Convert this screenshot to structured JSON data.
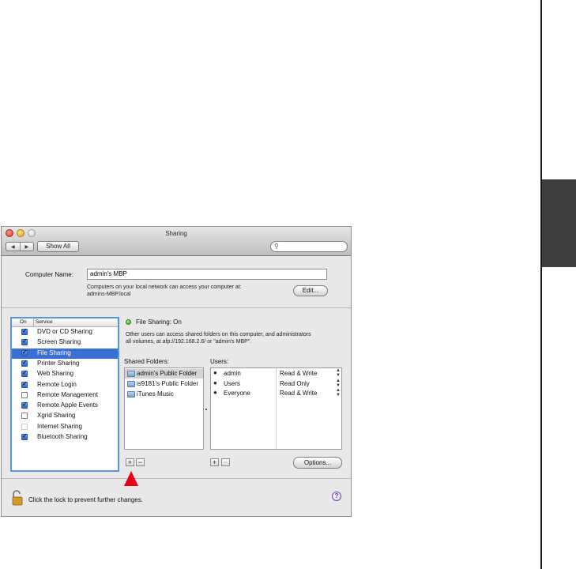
{
  "window": {
    "title": "Sharing",
    "nav_back": "◀",
    "nav_forward": "▶",
    "show_all": "Show All",
    "search_placeholder": ""
  },
  "computer_name": {
    "label": "Computer Name:",
    "value": "admin's MBP",
    "description_line1": "Computers on your local network can access your computer at:",
    "description_line2": "admins-MBP.local",
    "edit_button": "Edit..."
  },
  "services": {
    "col_on": "On",
    "col_service": "Service",
    "items": [
      {
        "name": "DVD or CD Sharing",
        "on": true,
        "selected": false
      },
      {
        "name": "Screen Sharing",
        "on": true,
        "selected": false
      },
      {
        "name": "File Sharing",
        "on": true,
        "selected": true
      },
      {
        "name": "Printer Sharing",
        "on": true,
        "selected": false
      },
      {
        "name": "Web Sharing",
        "on": true,
        "selected": false
      },
      {
        "name": "Remote Login",
        "on": true,
        "selected": false
      },
      {
        "name": "Remote Management",
        "on": false,
        "selected": false
      },
      {
        "name": "Remote Apple Events",
        "on": true,
        "selected": false
      },
      {
        "name": "Xgrid Sharing",
        "on": false,
        "selected": false
      },
      {
        "name": "Internet Sharing",
        "on": false,
        "selected": false
      },
      {
        "name": "Bluetooth Sharing",
        "on": true,
        "selected": false
      }
    ]
  },
  "file_sharing": {
    "status": "File Sharing: On",
    "status_color": "#2fa80e",
    "description_line1": "Other users can access shared folders on this computer, and administrators",
    "description_line2": "all volumes, at afp://192.168.2.6/ or \"admin's MBP\".",
    "shared_folders_label": "Shared Folders:",
    "users_label": "Users:",
    "folders": [
      {
        "name": "admin's Public Folder",
        "selected": true
      },
      {
        "name": "is9181's Public Folder",
        "selected": false
      },
      {
        "name": "iTunes Music",
        "selected": false
      }
    ],
    "users": [
      {
        "name": "admin",
        "icon": "single-user-icon",
        "permission": "Read & Write"
      },
      {
        "name": "Users",
        "icon": "group-icon",
        "permission": "Read Only"
      },
      {
        "name": "Everyone",
        "icon": "everyone-icon",
        "permission": "Read & Write"
      }
    ],
    "add_label": "+",
    "remove_label": "−",
    "options_button": "Options..."
  },
  "footer": {
    "lock_text": "Click the lock to prevent further changes.",
    "help_label": "?"
  },
  "annotation": {
    "pointer_color": "#e6001a"
  }
}
